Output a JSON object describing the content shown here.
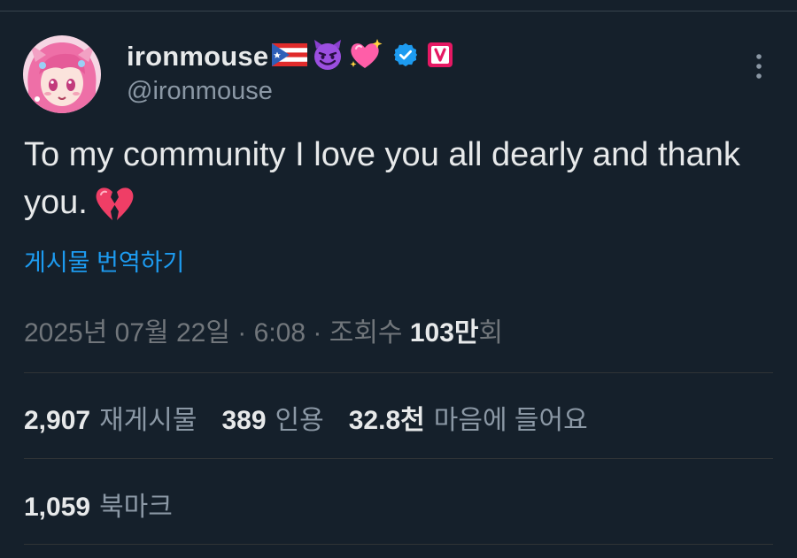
{
  "author": {
    "display_name": "ironmouse",
    "handle": "@ironmouse",
    "name_icons": [
      "puerto-rico-flag-icon",
      "smiling-devil-icon",
      "sparkling-heart-icon",
      "verified-badge-icon",
      "vtuber-v-badge-icon"
    ]
  },
  "tweet": {
    "text": "To my community I love you all dearly and thank you.",
    "emoji": "broken-heart-icon"
  },
  "translate_label": "게시물 번역하기",
  "meta": {
    "date": "2025년 07월 22일",
    "sep1": "·",
    "time": "6:08",
    "sep2": "·",
    "views_label": "조회수",
    "views_count": "103만",
    "views_suffix": "회"
  },
  "stats": {
    "reposts": {
      "count": "2,907",
      "label": "재게시물"
    },
    "quotes": {
      "count": "389",
      "label": "인용"
    },
    "likes": {
      "count": "32.8천",
      "label": "마음에 들어요"
    },
    "bookmarks": {
      "count": "1,059",
      "label": "북마크"
    }
  },
  "colors": {
    "background": "#15202b",
    "primary_text": "#e7e9ea",
    "secondary_text": "#8b98a5",
    "link": "#1d9bf0",
    "verified": "#1d9bf0",
    "divider": "#2f3336"
  }
}
